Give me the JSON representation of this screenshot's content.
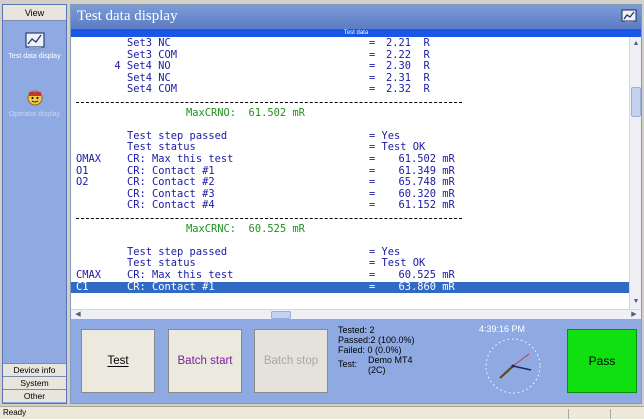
{
  "sidebar": {
    "header": "View",
    "items": [
      {
        "label": "Test data display",
        "icon": "chart-icon",
        "active": true
      },
      {
        "label": "Operator display",
        "icon": "operator-icon",
        "active": false
      }
    ],
    "bottom_buttons": [
      "Device info",
      "System",
      "Other"
    ]
  },
  "main": {
    "title": "Test data display",
    "strip_label": "Test data"
  },
  "log_lines": [
    {
      "kind": "row",
      "a": "",
      "b": "Set3 NC",
      "eq": "=",
      "v": "2.21  R"
    },
    {
      "kind": "row",
      "a": "",
      "b": "Set3 COM",
      "eq": "=",
      "v": "2.22  R"
    },
    {
      "kind": "row",
      "a": "",
      "b": "4 Set4 NO",
      "eq": "=",
      "v": "2.30  R",
      "indent": "out"
    },
    {
      "kind": "row",
      "a": "",
      "b": "Set4 NC",
      "eq": "=",
      "v": "2.31  R"
    },
    {
      "kind": "row",
      "a": "",
      "b": "Set4 COM",
      "eq": "=",
      "v": "2.32  R"
    },
    {
      "kind": "dash"
    },
    {
      "kind": "green",
      "text": "MaxCRNO:  61.502 mR"
    },
    {
      "kind": "blank"
    },
    {
      "kind": "row",
      "a": "",
      "b": "Test step passed",
      "eq": "= Yes",
      "v": ""
    },
    {
      "kind": "row",
      "a": "",
      "b": "Test status",
      "eq": "= Test OK",
      "v": ""
    },
    {
      "kind": "row",
      "a": "OMAX",
      "b": "CR: Max this test",
      "eq": "=",
      "v": "  61.502 mR"
    },
    {
      "kind": "row",
      "a": "O1",
      "b": "CR: Contact #1",
      "eq": "=",
      "v": "  61.349 mR"
    },
    {
      "kind": "row",
      "a": "O2",
      "b": "CR: Contact #2",
      "eq": "=",
      "v": "  65.748 mR"
    },
    {
      "kind": "row",
      "a": "",
      "b": "CR: Contact #3",
      "eq": "=",
      "v": "  60.320 mR"
    },
    {
      "kind": "row",
      "a": "",
      "b": "CR: Contact #4",
      "eq": "=",
      "v": "  61.152 mR"
    },
    {
      "kind": "dash"
    },
    {
      "kind": "green",
      "text": "MaxCRNC:  60.525 mR"
    },
    {
      "kind": "blank"
    },
    {
      "kind": "row",
      "a": "",
      "b": "Test step passed",
      "eq": "= Yes",
      "v": ""
    },
    {
      "kind": "row",
      "a": "",
      "b": "Test status",
      "eq": "= Test OK",
      "v": ""
    },
    {
      "kind": "row",
      "a": "CMAX",
      "b": "CR: Max this test",
      "eq": "=",
      "v": "  60.525 mR"
    },
    {
      "kind": "row",
      "a": "C1",
      "b": "CR: Contact #1",
      "eq": "=",
      "v": "  63.860 mR",
      "selected": true
    }
  ],
  "panel": {
    "test_button": "Test",
    "batch_start_button": "Batch start",
    "batch_stop_button": "Batch stop",
    "stats": {
      "tested": "Tested: 2",
      "passed": "Passed:2 (100.0%)",
      "failed": "Failed:  0 (0.0%)",
      "test_label": "Test:",
      "test_value_1": "Demo MT4",
      "test_value_2": "(2C)"
    },
    "clock_time": "4:39:16 PM",
    "result": "Pass"
  },
  "status_bar": {
    "text": "Ready"
  },
  "colors": {
    "sidebar": "#8fa9e2",
    "title_bar": "#5b7cc4",
    "strip": "#1a56e8",
    "selected_row": "#316ac5",
    "log_text": "#1a1aa6",
    "green_text": "#1f8f1f",
    "pass": "#10e010"
  }
}
